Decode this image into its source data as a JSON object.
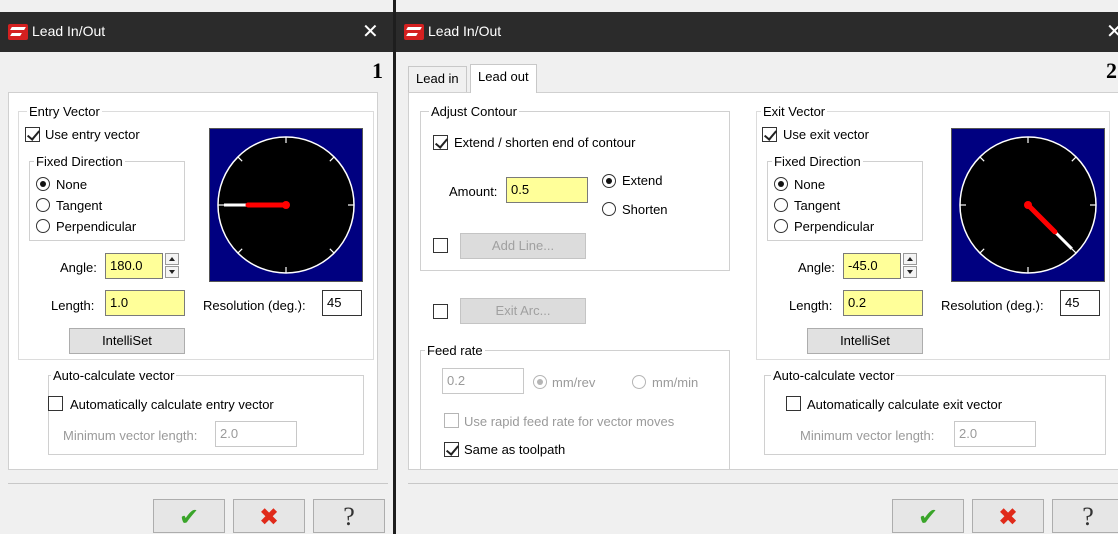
{
  "colors": {
    "titlebar": "#2b2b2b",
    "yellow_field": "#ffff99",
    "clock_bg": "#000080",
    "vector": "#ff0000"
  },
  "left": {
    "title": "Lead In/Out",
    "badge": "1",
    "entry_vector": {
      "group_label": "Entry Vector",
      "use_label": "Use entry vector",
      "use_checked": true,
      "fixed_direction": {
        "label": "Fixed Direction",
        "options": [
          "None",
          "Tangent",
          "Perpendicular"
        ],
        "selected": "None"
      },
      "angle_label": "Angle:",
      "angle_value": "180.0",
      "length_label": "Length:",
      "length_value": "1.0",
      "resolution_label": "Resolution (deg.):",
      "resolution_value": "45",
      "intelliset": "IntelliSet",
      "clock_angle_deg": 180
    },
    "auto_calc": {
      "label": "Auto-calculate vector",
      "check_label": "Automatically calculate entry vector",
      "checked": false,
      "min_label": "Minimum vector length:",
      "min_value": "2.0"
    },
    "buttons": {
      "ok_icon": "check-icon",
      "cancel_icon": "x-icon",
      "help_icon": "question-icon"
    }
  },
  "right": {
    "title": "Lead In/Out",
    "badge": "2",
    "tabs": [
      {
        "label": "Lead in",
        "active": false
      },
      {
        "label": "Lead out",
        "active": true
      }
    ],
    "adjust_contour": {
      "label": "Adjust Contour",
      "extend_label": "Extend / shorten end of contour",
      "extend_checked": true,
      "amount_label": "Amount:",
      "amount_value": "0.5",
      "options": [
        "Extend",
        "Shorten"
      ],
      "selected": "Extend",
      "add_line": "Add Line..."
    },
    "exit_arc": "Exit Arc...",
    "feed_rate": {
      "label": "Feed rate",
      "value": "0.2",
      "units": [
        "mm/rev",
        "mm/min"
      ],
      "selected": "mm/rev",
      "rapid_label": "Use rapid feed rate for vector moves",
      "rapid_checked": false,
      "same_label": "Same as toolpath",
      "same_checked": true
    },
    "exit_vector": {
      "group_label": "Exit Vector",
      "use_label": "Use exit vector",
      "use_checked": true,
      "fixed_direction": {
        "label": "Fixed Direction",
        "options": [
          "None",
          "Tangent",
          "Perpendicular"
        ],
        "selected": "None"
      },
      "angle_label": "Angle:",
      "angle_value": "-45.0",
      "length_label": "Length:",
      "length_value": "0.2",
      "resolution_label": "Resolution (deg.):",
      "resolution_value": "45",
      "intelliset": "IntelliSet",
      "clock_angle_deg": -45
    },
    "auto_calc": {
      "label": "Auto-calculate vector",
      "check_label": "Automatically calculate exit vector",
      "checked": false,
      "min_label": "Minimum vector length:",
      "min_value": "2.0"
    },
    "buttons": {
      "ok_icon": "check-icon",
      "cancel_icon": "x-icon",
      "help_icon": "question-icon"
    }
  }
}
